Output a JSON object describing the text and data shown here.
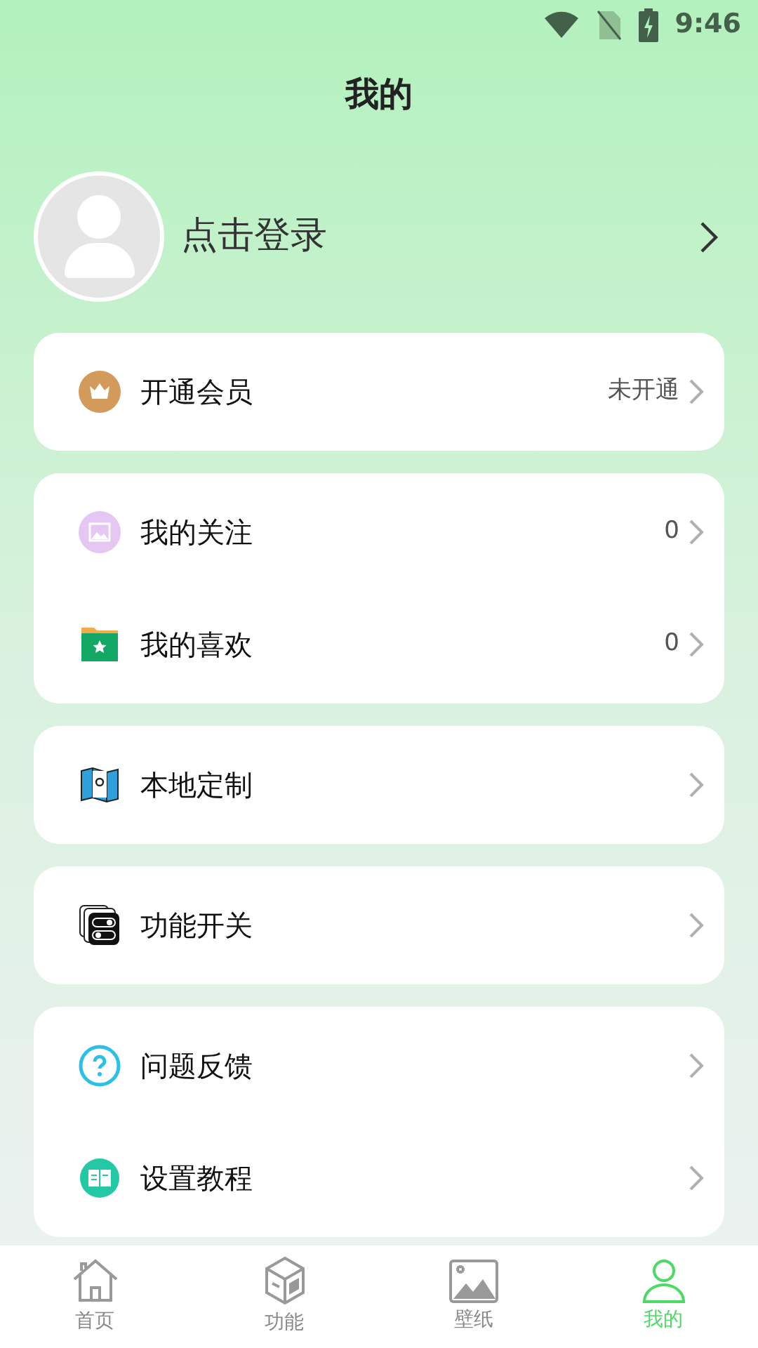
{
  "status_bar": {
    "time": "9:46"
  },
  "title": "我的",
  "profile": {
    "login_label": "点击登录"
  },
  "cards": [
    {
      "rows": [
        {
          "kind": "crown",
          "label": "开通会员",
          "value": "未开通"
        }
      ]
    },
    {
      "rows": [
        {
          "kind": "image",
          "label": "我的关注",
          "value": "0"
        },
        {
          "kind": "folder",
          "label": "我的喜欢",
          "value": "0"
        }
      ]
    },
    {
      "rows": [
        {
          "kind": "map",
          "label": "本地定制"
        }
      ]
    },
    {
      "rows": [
        {
          "kind": "switch",
          "label": "功能开关"
        }
      ]
    },
    {
      "rows": [
        {
          "kind": "help",
          "label": "问题反馈"
        },
        {
          "kind": "book",
          "label": "设置教程"
        }
      ]
    }
  ],
  "bottom_nav": [
    {
      "kind": "home",
      "label": "首页",
      "selected": false
    },
    {
      "kind": "cube",
      "label": "功能",
      "selected": false
    },
    {
      "kind": "wallpaper",
      "label": "壁纸",
      "selected": false
    },
    {
      "kind": "user",
      "label": "我的",
      "selected": true
    }
  ]
}
